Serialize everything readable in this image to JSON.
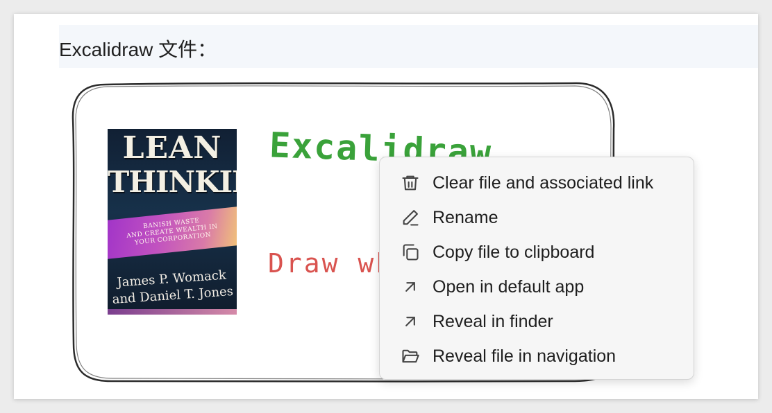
{
  "heading": "Excalidraw 文件：",
  "drawing": {
    "handwritten_green": "Excalidraw",
    "handwritten_red": "Draw wh",
    "book_cover": {
      "title_line1": "LEAN",
      "title_line2": "THINKING",
      "subtitle_line1": "BANISH WASTE",
      "subtitle_line2": "AND CREATE WEALTH IN",
      "subtitle_line3": "YOUR CORPORATION",
      "author_line1": "James P. Womack",
      "author_line2": "and Daniel T. Jones"
    }
  },
  "context_menu": {
    "items": [
      {
        "label": "Clear file and associated link",
        "icon": "trash-icon"
      },
      {
        "label": "Rename",
        "icon": "pencil-icon"
      },
      {
        "label": "Copy file to clipboard",
        "icon": "copy-icon"
      },
      {
        "label": "Open in default app",
        "icon": "arrow-up-right-icon"
      },
      {
        "label": "Reveal in finder",
        "icon": "arrow-up-right-icon"
      },
      {
        "label": "Reveal file in navigation",
        "icon": "folder-open-icon"
      }
    ]
  },
  "colors": {
    "handwriting_green": "#3aa23a",
    "handwriting_red": "#d9534f",
    "menu_background": "#f6f6f6",
    "heading_band": "#f4f7fb"
  }
}
